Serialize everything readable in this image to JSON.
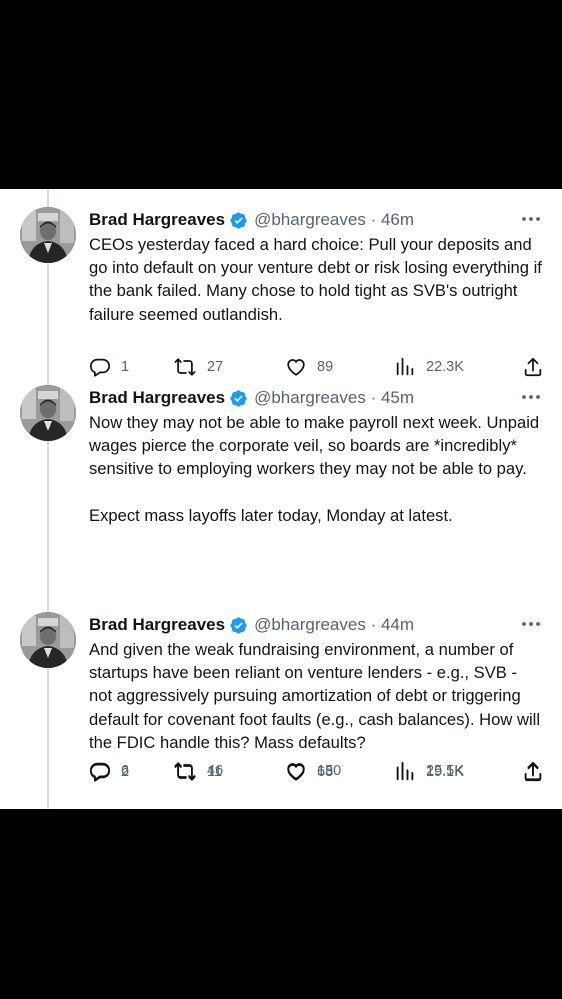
{
  "colors": {
    "background": "#000000",
    "panel": "#ffffff",
    "text": "#0f1419",
    "muted": "#536471",
    "verified": "#1d9bf0",
    "thread_line": "#cfd9de"
  },
  "icons": {
    "reply": "reply-icon",
    "retweet": "retweet-icon",
    "like": "like-icon",
    "views": "views-icon",
    "share": "share-icon",
    "more": "more-icon",
    "verified": "verified-badge-icon"
  },
  "tweets": [
    {
      "name": "Brad Hargreaves",
      "handle_time": "@bhargreaves · 46m",
      "paragraphs": [
        "CEOs yesterday faced a hard choice:  Pull your deposits and go into default on your venture debt or risk losing everything if the bank failed. Many chose to hold tight as SVB's outright failure seemed outlandish."
      ],
      "replies": "1",
      "retweets": "27",
      "likes": "89",
      "views": "22.3K"
    },
    {
      "name": "Brad Hargreaves",
      "handle_time": "@bhargreaves · 45m",
      "paragraphs": [
        "Now they may not be able to make payroll next week. Unpaid wages pierce the corporate veil, so boards are *incredibly* sensitive to employing workers they may not be able to pay.",
        "Expect mass layoffs later today, Monday at latest."
      ],
      "replies": "6",
      "retweets": "46",
      "likes": "150",
      "views": "25.5K"
    },
    {
      "name": "Brad Hargreaves",
      "handle_time": "@bhargreaves · 44m",
      "paragraphs": [
        "And given the weak fundraising environment, a number of startups have been reliant on venture lenders - e.g., SVB - not aggressively pursuing amortization of debt or triggering default for covenant foot faults (e.g., cash balances). How will the FDIC handle this?  Mass defaults?"
      ],
      "replies": "2",
      "retweets": "11",
      "likes": "68",
      "views": "19.1K"
    }
  ]
}
